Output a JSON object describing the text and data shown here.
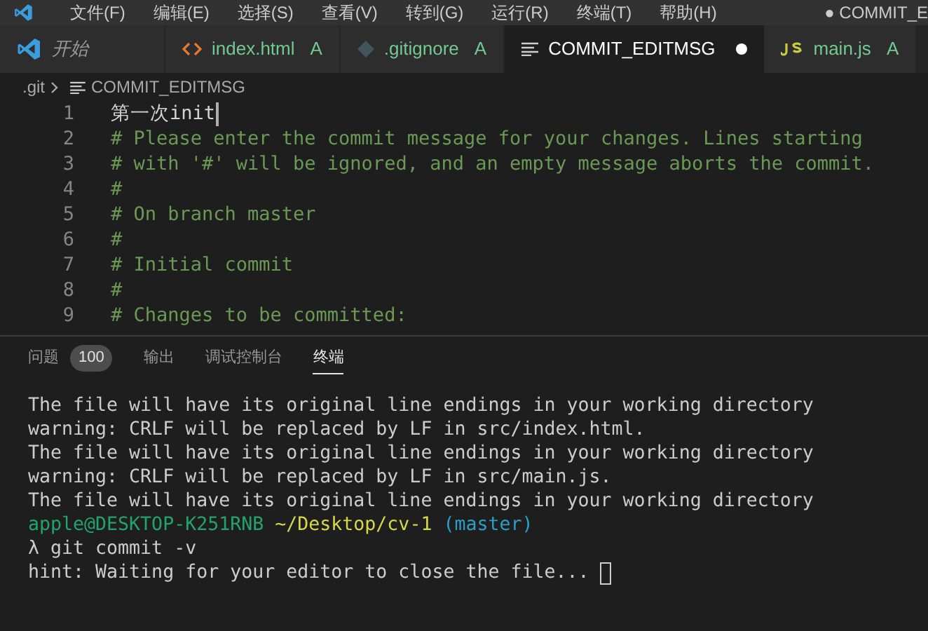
{
  "menu_bar": {
    "items": [
      "文件(F)",
      "编辑(E)",
      "选择(S)",
      "查看(V)",
      "转到(G)",
      "运行(R)",
      "终端(T)",
      "帮助(H)"
    ],
    "title": "● COMMIT_E"
  },
  "tabs": [
    {
      "label": "开始",
      "kind": "welcome",
      "modified": false,
      "selected": false
    },
    {
      "label": "index.html",
      "kind": "html",
      "badge": "A",
      "modified": false,
      "selected": false
    },
    {
      "label": ".gitignore",
      "kind": "git",
      "badge": "A",
      "modified": false,
      "selected": false
    },
    {
      "label": "COMMIT_EDITMSG",
      "kind": "text",
      "modified": true,
      "selected": true
    },
    {
      "label": "main.js",
      "kind": "js",
      "badge": "A",
      "modified": false,
      "selected": false
    }
  ],
  "breadcrumb": [
    ".git",
    "COMMIT_EDITMSG"
  ],
  "editor": {
    "lines": [
      {
        "number": "1",
        "text": "第一次init",
        "kind": "message",
        "cursor": true
      },
      {
        "number": "2",
        "text": "# Please enter the commit message for your changes. Lines starting",
        "kind": "comment"
      },
      {
        "number": "3",
        "text": "# with '#' will be ignored, and an empty message aborts the commit.",
        "kind": "comment"
      },
      {
        "number": "4",
        "text": "#",
        "kind": "comment"
      },
      {
        "number": "5",
        "text": "# On branch master",
        "kind": "comment"
      },
      {
        "number": "6",
        "text": "#",
        "kind": "comment"
      },
      {
        "number": "7",
        "text": "# Initial commit",
        "kind": "comment"
      },
      {
        "number": "8",
        "text": "#",
        "kind": "comment"
      },
      {
        "number": "9",
        "text": "# Changes to be committed:",
        "kind": "comment"
      }
    ]
  },
  "panel_tabs": [
    {
      "label": "问题",
      "count": "100",
      "selected": false
    },
    {
      "label": "输出",
      "selected": false
    },
    {
      "label": "调试控制台",
      "selected": false
    },
    {
      "label": "终端",
      "selected": true
    }
  ],
  "terminal": {
    "lines": [
      {
        "kind": "output",
        "text": "The file will have its original line endings in your working directory"
      },
      {
        "kind": "output",
        "text": "warning: CRLF will be replaced by LF in src/index.html."
      },
      {
        "kind": "output",
        "text": "The file will have its original line endings in your working directory"
      },
      {
        "kind": "output",
        "text": "warning: CRLF will be replaced by LF in src/main.js."
      },
      {
        "kind": "output",
        "text": "The file will have its original line endings in your working directory"
      },
      {
        "kind": "prompt",
        "user": "apple@DESKTOP-K251RNB",
        "path": "~/Desktop/cv-1",
        "branch": "(master)"
      },
      {
        "kind": "output",
        "text": "λ git commit -v"
      },
      {
        "kind": "output",
        "text": "hint: Waiting for your editor to close the file...",
        "cursor": true
      }
    ]
  }
}
